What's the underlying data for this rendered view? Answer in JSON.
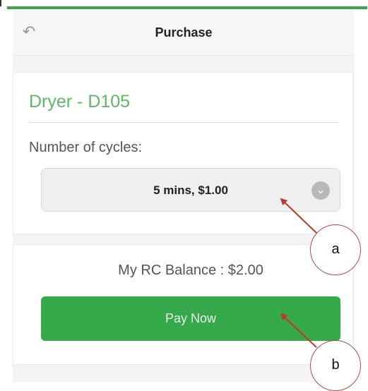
{
  "header": {
    "title": "Purchase",
    "back_icon": "back-arrow-icon"
  },
  "purchase": {
    "item_name": "Dryer - D105",
    "cycles_label": "Number of cycles:",
    "selected_cycle": "5 mins, $1.00",
    "dropdown_icon": "chevron-down-circle-icon"
  },
  "payment": {
    "balance_text": "My RC Balance : $2.00",
    "pay_button_label": "Pay Now"
  },
  "annotations": {
    "a_label": "a",
    "b_label": "b"
  },
  "colors": {
    "accent_green": "#36a94b",
    "title_green": "#5fb865",
    "annotation_red": "#c0392b"
  }
}
